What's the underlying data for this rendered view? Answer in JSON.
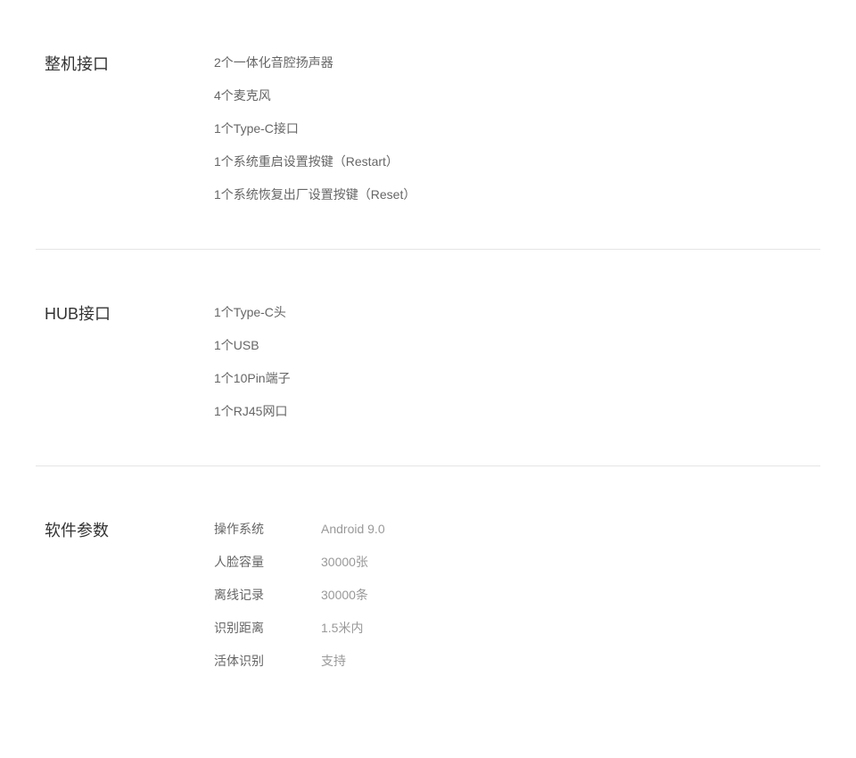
{
  "sections": [
    {
      "title": "整机接口",
      "type": "list",
      "items": [
        "2个一体化音腔扬声器",
        "4个麦克风",
        "1个Type-C接口",
        "1个系统重启设置按键（Restart）",
        "1个系统恢复出厂设置按键（Reset）"
      ]
    },
    {
      "title": "HUB接口",
      "type": "list",
      "items": [
        "1个Type-C头",
        "1个USB",
        "1个10Pin端子",
        "1个RJ45网口"
      ]
    },
    {
      "title": "软件参数",
      "type": "kv",
      "rows": [
        {
          "label": "操作系统",
          "value": "Android 9.0"
        },
        {
          "label": "人脸容量",
          "value": "30000张"
        },
        {
          "label": "离线记录",
          "value": "30000条"
        },
        {
          "label": "识别距离",
          "value": "1.5米内"
        },
        {
          "label": "活体识别",
          "value": "支持"
        }
      ]
    }
  ]
}
